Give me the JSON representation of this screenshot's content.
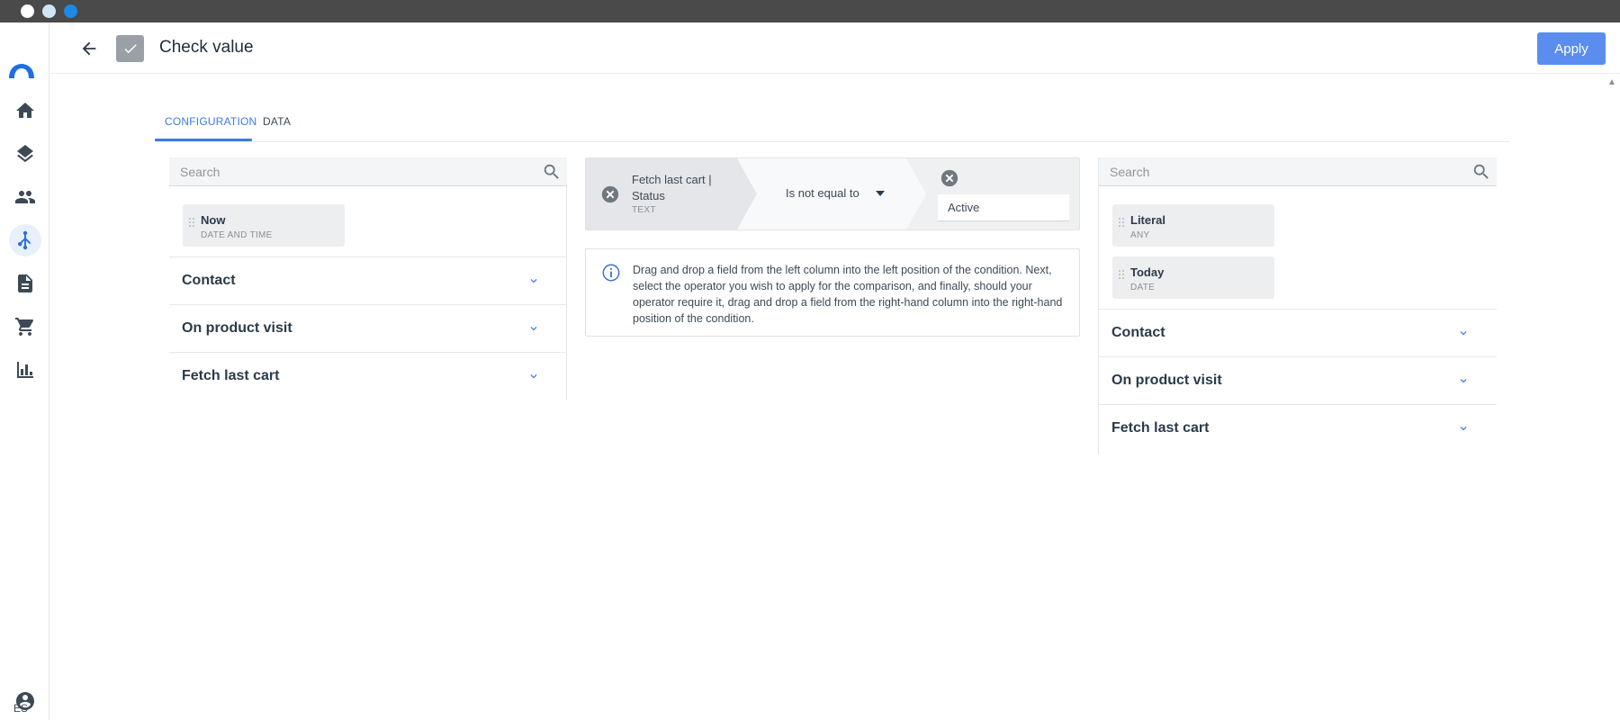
{
  "header": {
    "title": "Check value",
    "apply_label": "Apply"
  },
  "rail": {
    "language": "ES",
    "items": [
      "home-icon",
      "layers-icon",
      "people-icon",
      "flow-icon",
      "document-icon",
      "cart-icon",
      "bar-chart-icon",
      "account-icon"
    ],
    "active_item": "flow-icon"
  },
  "colors": {
    "accent": "#3b7be0",
    "apply_button": "#5b8def"
  },
  "tabs": [
    {
      "label": "CONFIGURATION",
      "active": true
    },
    {
      "label": "DATA",
      "active": false
    }
  ],
  "left_column": {
    "search_placeholder": "Search",
    "chips": [
      {
        "name": "Now",
        "type": "DATE AND TIME"
      }
    ],
    "groups": [
      "Contact",
      "On product visit",
      "Fetch last cart"
    ]
  },
  "right_column": {
    "search_placeholder": "Search",
    "chips": [
      {
        "name": "Literal",
        "type": "ANY"
      },
      {
        "name": "Today",
        "type": "DATE"
      }
    ],
    "groups": [
      "Contact",
      "On product visit",
      "Fetch last cart"
    ]
  },
  "condition": {
    "left_field": "Fetch last cart | Status",
    "left_type": "TEXT",
    "operator": "Is not equal to",
    "right_value": "Active"
  },
  "info": {
    "text": "Drag and drop a field from the left column into the left position of the condition. Next, select the operator you wish to apply for the comparison, and finally, should your operator require it, drag and drop a field from the right-hand column into the right-hand position of the condition."
  }
}
